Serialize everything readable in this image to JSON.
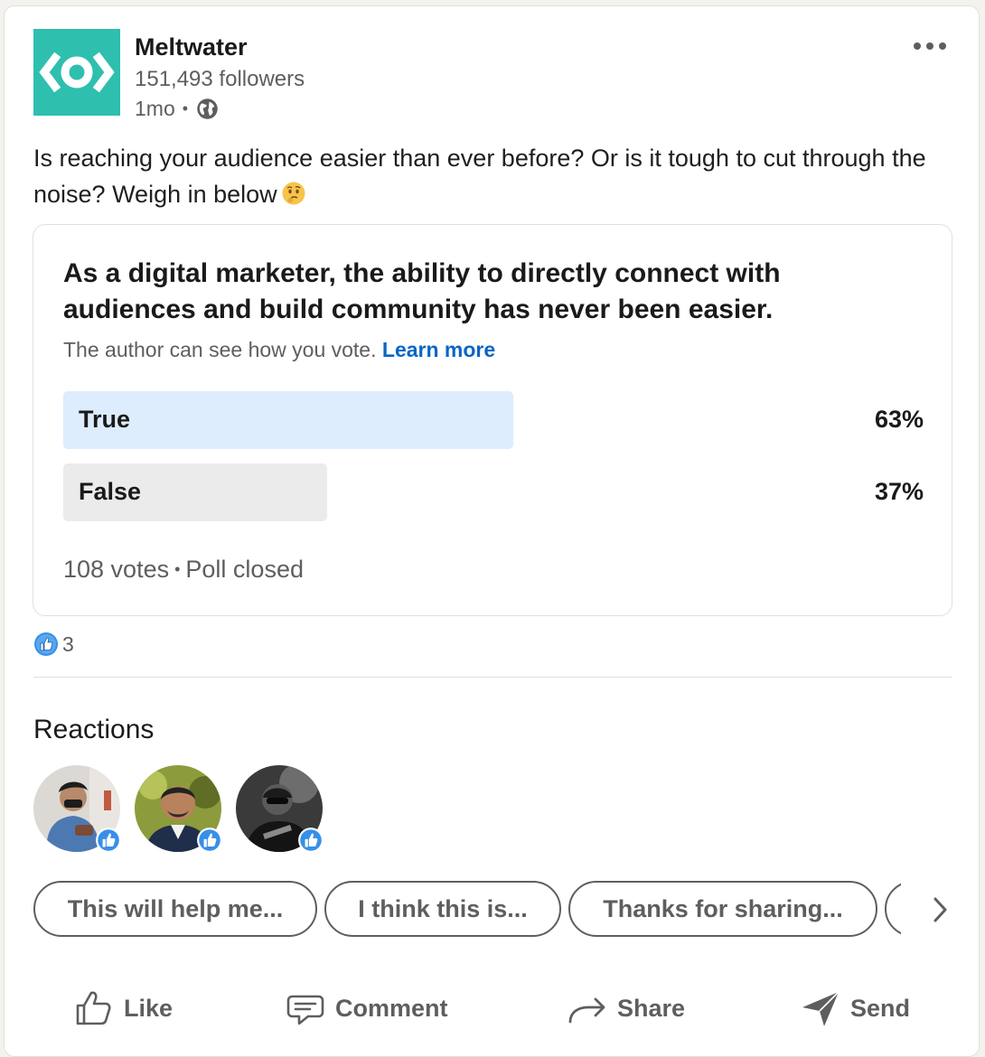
{
  "post": {
    "author": "Meltwater",
    "followers": "151,493 followers",
    "age": "1mo",
    "meta_sep": "•",
    "visibility_icon": "globe-icon",
    "text": "Is reaching your audience easier than ever before? Or is it tough to cut through the noise? Weigh in below",
    "emoji": "thinking-face-emoji"
  },
  "poll": {
    "question": "As a digital marketer, the ability to directly connect with audiences and build community has never been easier.",
    "note": "The author can see how you vote.",
    "learn_more": "Learn more",
    "options": [
      {
        "label": "True",
        "percent": "63%",
        "fill": 0.63,
        "color": "#deedfd"
      },
      {
        "label": "False",
        "percent": "37%",
        "fill": 0.37,
        "color": "#ebebeb"
      }
    ],
    "votes": "108 votes",
    "foot_sep": "•",
    "status": "Poll closed"
  },
  "reactions": {
    "count": "3",
    "title": "Reactions"
  },
  "suggestions": [
    "This will help me...",
    "I think this is...",
    "Thanks for sharing..."
  ],
  "actions": {
    "like": "Like",
    "comment": "Comment",
    "share": "Share",
    "send": "Send"
  },
  "colors": {
    "brand": "#2ebfae",
    "link": "#0a66c2",
    "like_blue": "#378fe9"
  }
}
